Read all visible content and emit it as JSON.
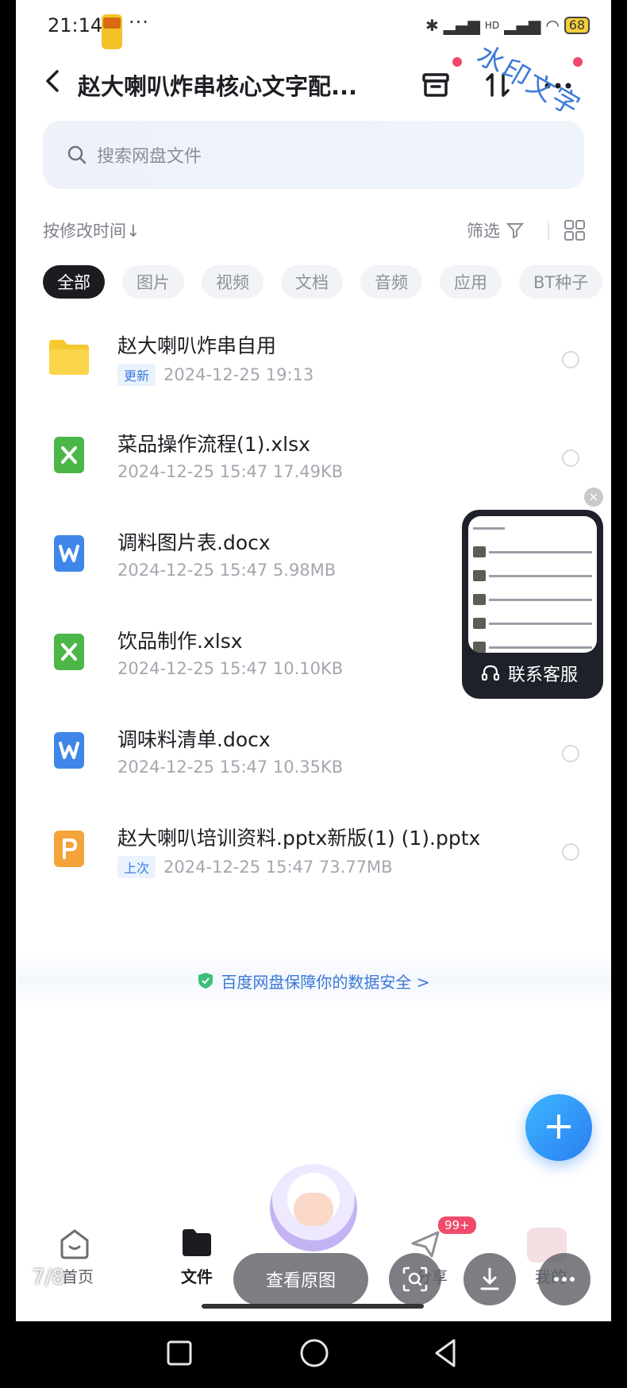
{
  "status_bar": {
    "time": "21:14",
    "dots": "···",
    "network": "HD",
    "battery": "68"
  },
  "header": {
    "title": "赵大喇叭炸串核心文字配...",
    "watermark": "水印文字"
  },
  "search": {
    "placeholder": "搜索网盘文件"
  },
  "toolbar": {
    "sort_label": "按修改时间↓",
    "filter_label": "筛选"
  },
  "chips": [
    "全部",
    "图片",
    "视频",
    "文档",
    "音频",
    "应用",
    "BT种子"
  ],
  "files": [
    {
      "name": "赵大喇叭炸串自用",
      "tag": "更新",
      "meta": "2024-12-25  19:13",
      "icon": "folder-icon"
    },
    {
      "name": "菜品操作流程(1).xlsx",
      "tag": "",
      "meta": "2024-12-25  15:47  17.49KB",
      "icon": "excel-icon"
    },
    {
      "name": "调料图片表.docx",
      "tag": "",
      "meta": "2024-12-25  15:47  5.98MB",
      "icon": "word-icon"
    },
    {
      "name": "饮品制作.xlsx",
      "tag": "",
      "meta": "2024-12-25  15:47  10.10KB",
      "icon": "excel-icon"
    },
    {
      "name": "调味料清单.docx",
      "tag": "",
      "meta": "2024-12-25  15:47  10.35KB",
      "icon": "word-icon"
    },
    {
      "name": "赵大喇叭培训资料.pptx新版(1) (1).pptx",
      "tag": "上次",
      "meta": "2024-12-25  15:47  73.77MB",
      "icon": "ppt-icon"
    }
  ],
  "secure_note": "百度网盘保障你的数据安全 >",
  "widget": {
    "label": "联系客服",
    "close": "×"
  },
  "fab": "+",
  "bottom_nav": {
    "home": "首页",
    "files": "文件",
    "share": "分享",
    "mine": "我的",
    "badge": "99+"
  },
  "viewer": {
    "pager": "7/8",
    "view_original": "查看原图"
  },
  "colors": {
    "accent": "#2a7ff0",
    "excel": "#4cb648",
    "word": "#3f86e8",
    "ppt": "#f4a43a",
    "folder": "#f6c92f"
  }
}
